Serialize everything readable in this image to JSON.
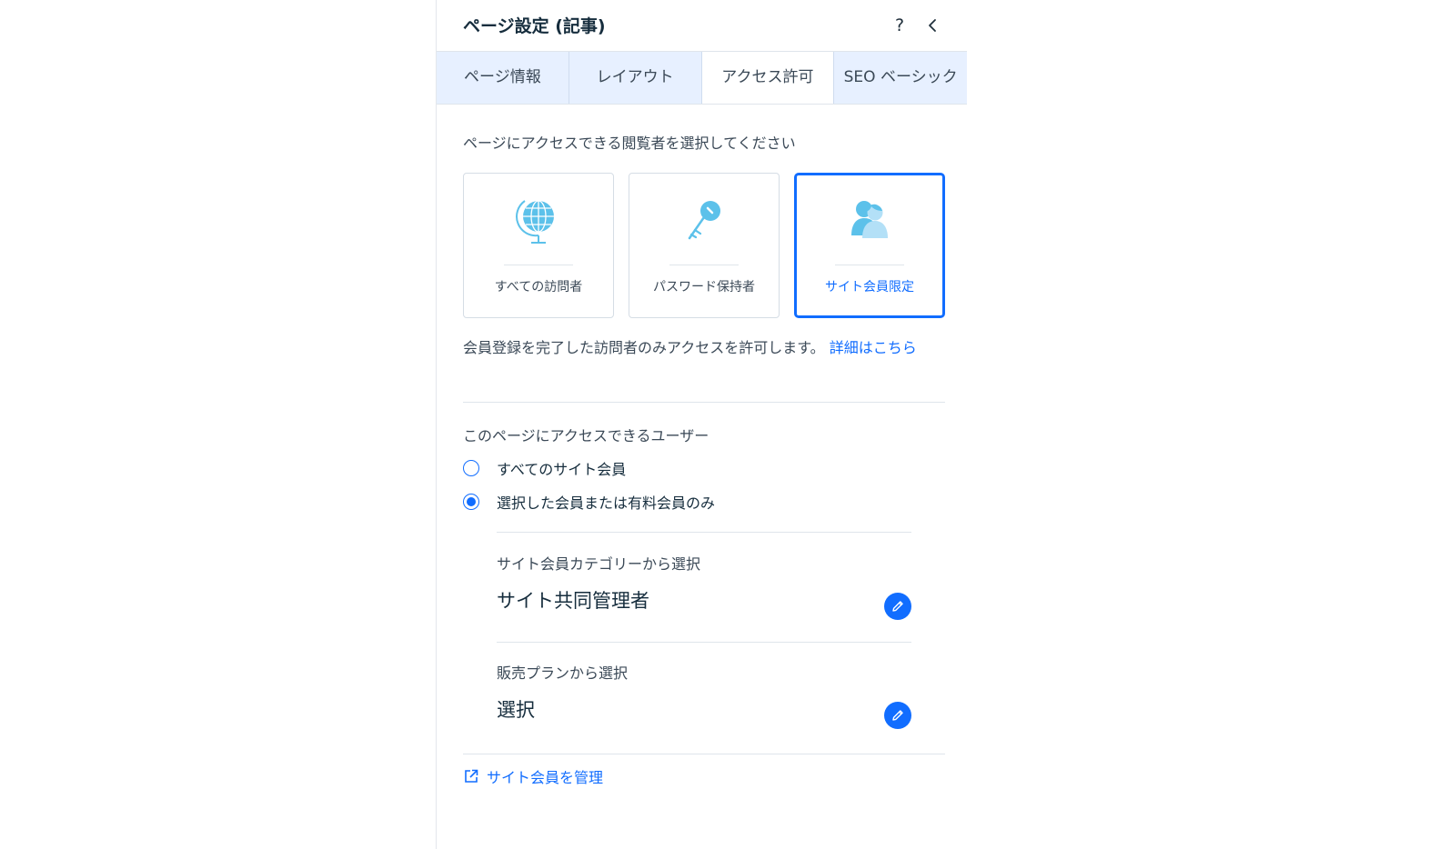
{
  "header": {
    "title": "ページ設定 (記事)",
    "help_label": "?"
  },
  "tabs": [
    {
      "label": "ページ情報",
      "active": false
    },
    {
      "label": "レイアウト",
      "active": false
    },
    {
      "label": "アクセス許可",
      "active": true
    },
    {
      "label": "SEO ベーシック",
      "active": false
    }
  ],
  "access": {
    "prompt": "ページにアクセスできる閲覧者を選択してください",
    "options": [
      {
        "label": "すべての訪問者",
        "icon": "globe-icon",
        "selected": false
      },
      {
        "label": "パスワード保持者",
        "icon": "key-icon",
        "selected": false
      },
      {
        "label": "サイト会員限定",
        "icon": "members-icon",
        "selected": true
      }
    ],
    "description": "会員登録を完了した訪問者のみアクセスを許可します。",
    "learn_more": "詳細はこちら"
  },
  "members": {
    "heading": "このページにアクセスできるユーザー",
    "radios": [
      {
        "label": "すべてのサイト会員",
        "checked": false
      },
      {
        "label": "選択した会員または有料会員のみ",
        "checked": true
      }
    ],
    "category": {
      "label": "サイト会員カテゴリーから選択",
      "value": "サイト共同管理者"
    },
    "plan": {
      "label": "販売プランから選択",
      "value": "選択"
    }
  },
  "footer": {
    "manage_link": "サイト会員を管理"
  },
  "colors": {
    "accent": "#116dff",
    "tab_background": "#e7f0ff",
    "icon_blue": "#5cc1ea",
    "icon_light_blue": "#b3e0f7"
  }
}
